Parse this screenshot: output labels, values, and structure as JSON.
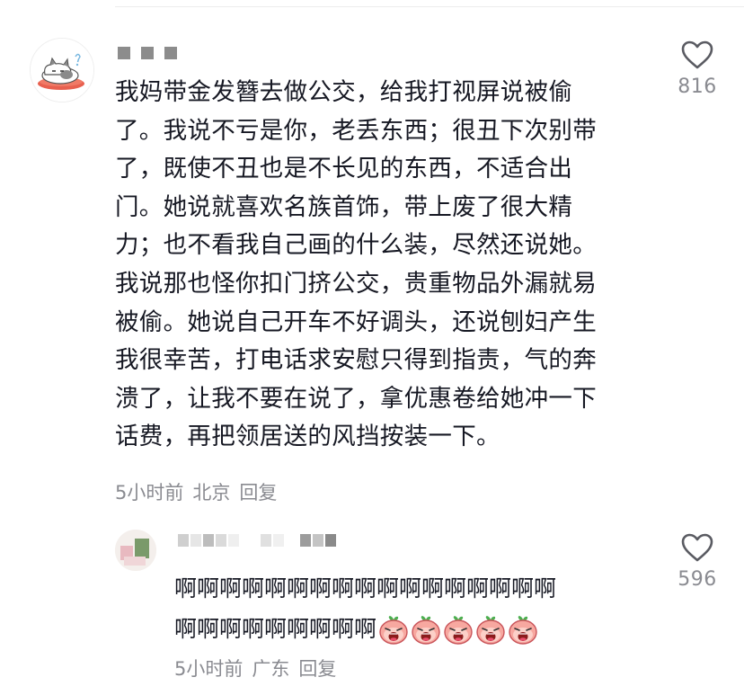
{
  "comment": {
    "lines": [
      "我妈带金发簪去做公交，给我打视屏说被偷",
      "了。我说不亏是你，老丢东西；很丑下次别带",
      "了，既使不丑也是不长见的东西，不适合出",
      "门。她说就喜欢名族首饰，带上废了很大精",
      "力；也不看我自己画的什么装，尽然还说她。",
      "我说那也怪你扣门挤公交，贵重物品外漏就易",
      "被偷。她说自己开车不好调头，还说刨妇产生",
      "我很幸苦，打电话求安慰只得到指责，气的奔",
      "溃了，让我不要在说了，拿优惠卷给她冲一下",
      "话费，再把领居送的风挡按装一下。"
    ],
    "time": "5小时前",
    "location": "北京",
    "reply_label": "回复",
    "like_count": "816",
    "like_icon": "heart-outline-icon"
  },
  "reply": {
    "lines": [
      "啊啊啊啊啊啊啊啊啊啊啊啊啊啊啊啊啊",
      "啊啊啊啊啊啊啊啊啊"
    ],
    "emoji_icons": [
      "screaming-face-icon",
      "screaming-face-icon",
      "screaming-face-icon",
      "screaming-face-icon",
      "screaming-face-icon"
    ],
    "time": "5小时前",
    "location": "广东",
    "reply_label": "回复",
    "like_count": "596",
    "like_icon": "heart-outline-icon"
  },
  "colors": {
    "text": "#161823",
    "meta": "#8a8b91",
    "divider": "#ececec"
  }
}
